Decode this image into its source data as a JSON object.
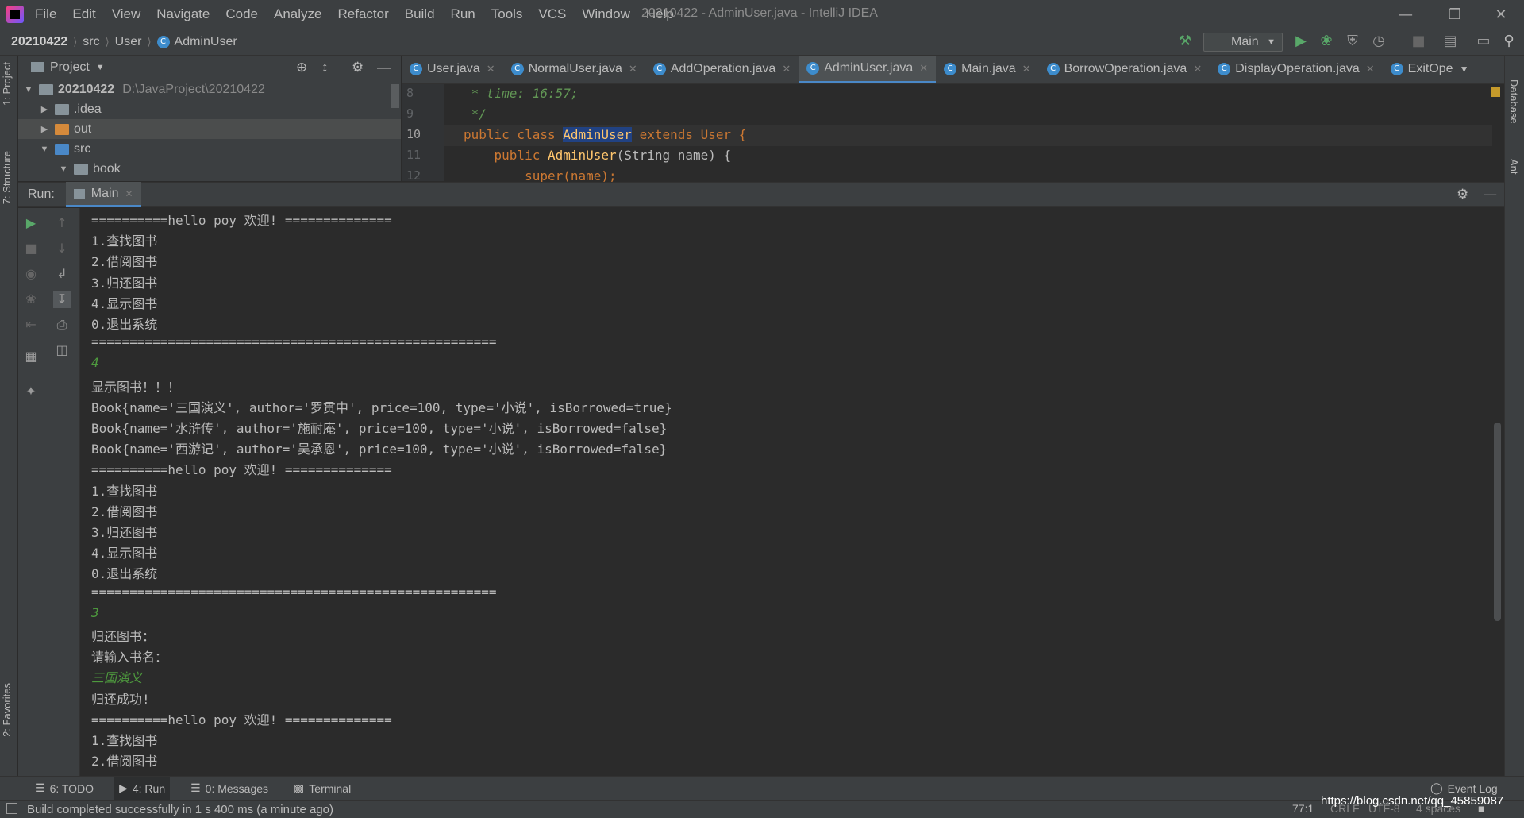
{
  "menu": [
    "File",
    "Edit",
    "View",
    "Navigate",
    "Code",
    "Analyze",
    "Refactor",
    "Build",
    "Run",
    "Tools",
    "VCS",
    "Window",
    "Help"
  ],
  "window_title": "20210422 - AdminUser.java - IntelliJ IDEA",
  "breadcrumb": {
    "project": "20210422",
    "folder1": "src",
    "folder2": "User",
    "file": "AdminUser"
  },
  "run_config": "Main",
  "project_panel": {
    "title": "Project",
    "root": "20210422",
    "root_path": "D:\\JavaProject\\20210422",
    "items": [
      ".idea",
      "out",
      "src",
      "book"
    ]
  },
  "left_tabs": {
    "project": "1: Project",
    "structure": "7: Structure",
    "favorites": "2: Favorites"
  },
  "right_tabs": {
    "database": "Database",
    "ant": "Ant"
  },
  "editor_tabs": [
    "User.java",
    "NormalUser.java",
    "AddOperation.java",
    "AdminUser.java",
    "Main.java",
    "BorrowOperation.java",
    "DisplayOperation.java",
    "ExitOpe"
  ],
  "code": {
    "lines": [
      "8",
      "9",
      "10",
      "11",
      "12"
    ],
    "l8": " * time: 16:57;",
    "l9": " */",
    "l10_a": "public class ",
    "l10_b": "AdminUser",
    "l10_c": " extends User {",
    "l11_a": "    public ",
    "l11_b": "AdminUser",
    "l11_c": "(String name) {",
    "l12": "        super(name);"
  },
  "run": {
    "label": "Run:",
    "tab": "Main"
  },
  "console": [
    {
      "t": "==========hello poy 欢迎! =============="
    },
    {
      "t": "1.查找图书"
    },
    {
      "t": "2.借阅图书"
    },
    {
      "t": "3.归还图书"
    },
    {
      "t": "4.显示图书"
    },
    {
      "t": "0.退出系统"
    },
    {
      "t": "====================================================="
    },
    {
      "t": "4",
      "input": true
    },
    {
      "t": "显示图书！！！"
    },
    {
      "t": "Book{name='三国演义', author='罗贯中', price=100, type='小说', isBorrowed=true}"
    },
    {
      "t": "Book{name='水浒传', author='施耐庵', price=100, type='小说', isBorrowed=false}"
    },
    {
      "t": "Book{name='西游记', author='吴承恩', price=100, type='小说', isBorrowed=false}"
    },
    {
      "t": "==========hello poy 欢迎! =============="
    },
    {
      "t": "1.查找图书"
    },
    {
      "t": "2.借阅图书"
    },
    {
      "t": "3.归还图书"
    },
    {
      "t": "4.显示图书"
    },
    {
      "t": "0.退出系统"
    },
    {
      "t": "====================================================="
    },
    {
      "t": "3",
      "input": true
    },
    {
      "t": "归还图书："
    },
    {
      "t": "请输入书名："
    },
    {
      "t": "三国演义",
      "input": true
    },
    {
      "t": "归还成功!"
    },
    {
      "t": "==========hello poy 欢迎! =============="
    },
    {
      "t": "1.查找图书"
    },
    {
      "t": "2.借阅图书"
    }
  ],
  "bottom_tabs": {
    "todo": "6: TODO",
    "run": "4: Run",
    "messages": "0: Messages",
    "terminal": "Terminal",
    "event_log": "Event Log"
  },
  "status": {
    "message": "Build completed successfully in 1 s 400 ms (a minute ago)",
    "position": "77:1",
    "line_sep": "CRLF",
    "encoding": "UTF-8",
    "indent": "4 spaces"
  },
  "watermark": "https://blog.csdn.net/qq_45859087",
  "colors": {
    "accent": "#4a88c7",
    "keyword": "#cc7832",
    "comment": "#629755",
    "function": "#ffc66d",
    "input": "#4e9a3e",
    "run_green": "#59a869"
  }
}
